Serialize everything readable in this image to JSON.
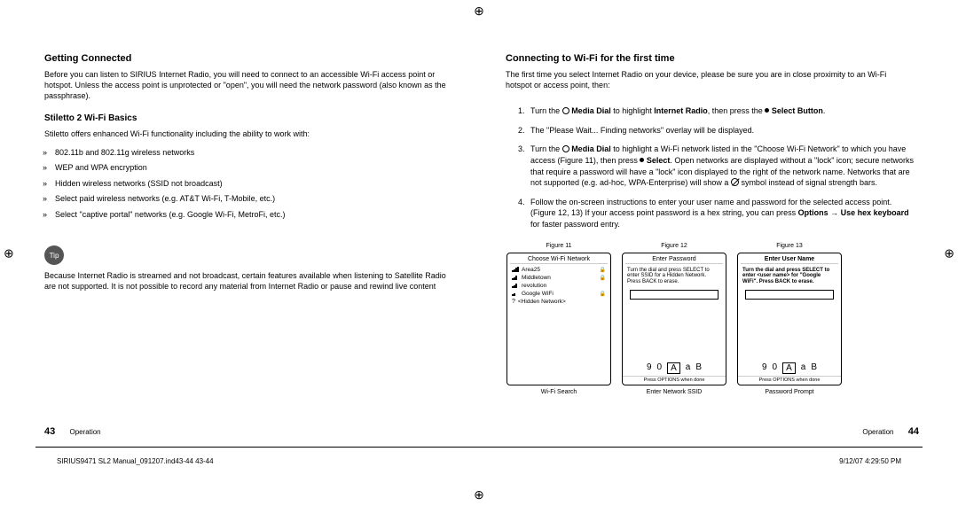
{
  "left": {
    "h1": "Getting Connected",
    "p1": "Before you can listen to SIRIUS Internet Radio, you will need to connect to an accessible Wi-Fi access point or hotspot. Unless the access point is unprotected or \"open\", you will need the network password (also known as the passphrase).",
    "h2": "Stiletto 2 Wi-Fi Basics",
    "p2": "Stiletto offers enhanced Wi-Fi functionality including the ability to work with:",
    "bullets": [
      "802.11b and 802.11g wireless networks",
      "WEP and WPA encryption",
      "Hidden wireless networks (SSID not broadcast)",
      "Select paid wireless networks (e.g. AT&T Wi-Fi, T-Mobile, etc.)",
      "Select \"captive portal\" networks (e.g. Google Wi-Fi, MetroFi, etc.)"
    ],
    "tip_label": "Tip",
    "tip_body": "Because Internet Radio is streamed and not broadcast, certain features available when listening to Satellite Radio are not supported. It is not possible to record any material from Internet Radio or pause and rewind live content"
  },
  "right": {
    "h1": "Connecting to Wi-Fi for the first time",
    "p1": "The first time you select Internet Radio on your device, please be sure you are in close proximity to an Wi-Fi hotspot or access point, then:",
    "step1_a": "Turn the ",
    "step1_b": " Media Dial",
    "step1_c": " to highlight ",
    "step1_d": "Internet Radio",
    "step1_e": ", then press the ",
    "step1_f": " Select Button",
    "step1_g": ".",
    "step2": "The \"Please Wait... Finding networks\" overlay will be displayed.",
    "step3_a": "Turn the ",
    "step3_b": " Media Dial",
    "step3_c": " to highlight a Wi-Fi network listed in the \"Choose Wi-Fi Network\" to which you have access (Figure 11), then press ",
    "step3_d": " Select",
    "step3_e": ". Open networks are displayed without a \"lock\" icon; secure networks that require a password will have a \"lock\" icon displayed to the right of the network name. Networks that are not supported (e.g. ad-hoc, WPA-Enterprise) will show a ",
    "step3_f": " symbol instead of signal strength bars.",
    "step4_a": "Follow the on-screen instructions to enter your user name and password for the selected access point. (Figure 12, 13) If your access point password is a hex string, you can press ",
    "step4_b": "Options → Use hex keyboard",
    "step4_c": " for faster password entry.",
    "fig11": {
      "top": "Figure 11",
      "title": "Choose Wi-Fi Network",
      "rows": [
        {
          "name": "Area25",
          "lock": true
        },
        {
          "name": "Middletown",
          "lock": true
        },
        {
          "name": "revolution",
          "lock": false
        },
        {
          "name": "Google WiFi",
          "lock": true
        },
        {
          "name": "<Hidden Network>",
          "lock": false,
          "unknown": true
        }
      ],
      "bot": "Wi-Fi Search"
    },
    "fig12": {
      "top": "Figure 12",
      "title": "Enter Password",
      "body": "Turn the dial and press SELECT to enter SSID for a Hidden Network.\nPress BACK to erase.",
      "keys": [
        "9",
        "0",
        "A",
        "a",
        "B"
      ],
      "foot": "Press OPTIONS when done",
      "bot": "Enter Network SSID"
    },
    "fig13": {
      "top": "Figure 13",
      "title": "Enter User Name",
      "body": "Turn the dial and press SELECT to enter <user name> for \"Google WiFi\".\nPress BACK to erase.",
      "keys": [
        "9",
        "0",
        "A",
        "a",
        "B"
      ],
      "foot": "Press OPTIONS when done",
      "bot": "Password Prompt"
    }
  },
  "footer": {
    "left_num": "43",
    "left_sec": "Operation",
    "right_sec": "Operation",
    "right_num": "44",
    "meta_left": "SIRIUS9471 SL2 Manual_091207.ind43-44   43-44",
    "meta_right": "9/12/07   4:29:50 PM"
  }
}
